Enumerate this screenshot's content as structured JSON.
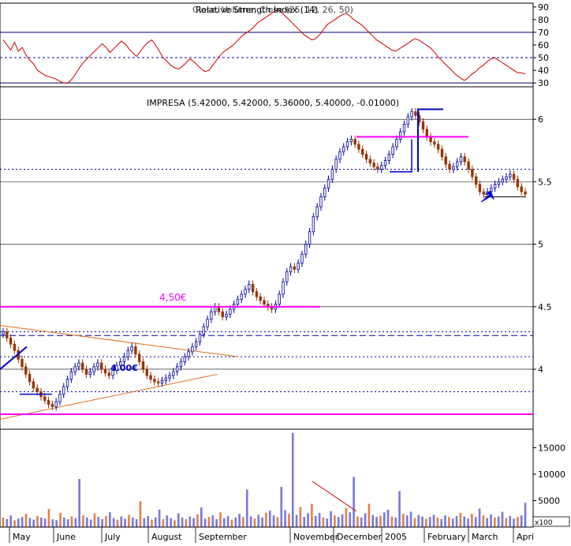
{
  "chart_data": [
    {
      "panel": "rsi",
      "type": "line",
      "title": "Relative Strength Index (14)",
      "overlay_text": "Close, Volume, Close (25, 12, 26, 50)",
      "y_ticks": [
        90,
        80,
        70,
        60,
        50,
        40,
        30
      ],
      "ylim": [
        27,
        93
      ],
      "reference_lines": [
        70,
        50,
        30
      ],
      "series": [
        {
          "color": "#cc0000",
          "values": [
            64,
            60,
            56,
            62,
            55,
            58,
            52,
            48,
            45,
            40,
            38,
            36,
            35,
            34,
            33,
            31,
            30,
            30,
            33,
            37,
            42,
            46,
            49,
            52,
            55,
            58,
            61,
            58,
            54,
            57,
            60,
            63,
            61,
            57,
            54,
            51,
            55,
            59,
            62,
            64,
            60,
            55,
            50,
            47,
            44,
            42,
            41,
            43,
            46,
            49,
            47,
            44,
            41,
            39,
            40,
            44,
            48,
            52,
            55,
            57,
            59,
            62,
            65,
            68,
            70,
            72,
            75,
            78,
            80,
            82,
            84,
            86,
            88,
            86,
            83,
            80,
            77,
            74,
            71,
            68,
            66,
            64,
            65,
            68,
            72,
            76,
            78,
            80,
            82,
            84,
            85,
            83,
            80,
            78,
            76,
            73,
            70,
            67,
            64,
            62,
            60,
            58,
            56,
            55,
            57,
            59,
            61,
            63,
            65,
            64,
            62,
            60,
            58,
            55,
            51,
            48,
            45,
            42,
            39,
            36,
            34,
            32,
            34,
            37,
            39,
            42,
            44,
            47,
            49,
            50,
            48,
            46,
            44,
            42,
            40,
            38,
            38,
            37
          ]
        }
      ]
    },
    {
      "panel": "price",
      "type": "candlestick",
      "title": "IMPRESA (5.42000, 5.42000, 5.36000, 5.40000, -0.01000)",
      "y_ticks": [
        6.0,
        5.5,
        5.0,
        4.5,
        4.0
      ],
      "ylim": [
        3.52,
        6.26
      ],
      "x_labels": [
        "May",
        "June",
        "July",
        "August",
        "September",
        "November",
        "December",
        "2005",
        "February",
        "March",
        "Apri"
      ],
      "close": [
        4.3,
        4.25,
        4.2,
        4.15,
        4.08,
        4.02,
        3.96,
        3.9,
        3.85,
        3.82,
        3.78,
        3.75,
        3.72,
        3.7,
        3.74,
        3.8,
        3.86,
        3.92,
        3.98,
        4.02,
        4.05,
        4.0,
        3.96,
        3.98,
        4.02,
        4.05,
        4.0,
        3.97,
        3.95,
        3.99,
        4.03,
        4.06,
        4.1,
        4.15,
        4.18,
        4.12,
        4.06,
        4.0,
        3.95,
        3.92,
        3.9,
        3.89,
        3.91,
        3.93,
        3.95,
        3.98,
        4.02,
        4.06,
        4.1,
        4.14,
        4.18,
        4.22,
        4.28,
        4.34,
        4.4,
        4.46,
        4.5,
        4.46,
        4.42,
        4.44,
        4.48,
        4.52,
        4.56,
        4.6,
        4.64,
        4.68,
        4.62,
        4.58,
        4.55,
        4.52,
        4.5,
        4.48,
        4.52,
        4.6,
        4.7,
        4.78,
        4.82,
        4.8,
        4.85,
        4.92,
        5.0,
        5.1,
        5.22,
        5.3,
        5.38,
        5.45,
        5.52,
        5.6,
        5.68,
        5.74,
        5.78,
        5.82,
        5.84,
        5.8,
        5.76,
        5.72,
        5.68,
        5.65,
        5.62,
        5.6,
        5.63,
        5.67,
        5.72,
        5.78,
        5.84,
        5.9,
        5.96,
        6.02,
        6.06,
        6.03,
        5.98,
        5.92,
        5.86,
        5.82,
        5.8,
        5.76,
        5.7,
        5.64,
        5.6,
        5.62,
        5.66,
        5.7,
        5.66,
        5.6,
        5.54,
        5.48,
        5.42,
        5.4,
        5.42,
        5.45,
        5.48,
        5.5,
        5.52,
        5.54,
        5.56,
        5.52,
        5.46,
        5.42,
        5.4
      ],
      "reference_lines": [
        {
          "value": 5.86,
          "color": "#ff00ff",
          "label": ""
        },
        {
          "value": 4.5,
          "color": "#ff00ff",
          "label": "4,50€"
        },
        {
          "value": 3.64,
          "color": "#ff00ff",
          "label": ""
        },
        {
          "value": 4.0,
          "color": "#0000cc",
          "label": "4.00€"
        }
      ],
      "annotations": [
        "4,50€",
        "4.00€"
      ]
    },
    {
      "panel": "volume",
      "type": "bar",
      "title": "",
      "y_ticks": [
        15000,
        10000,
        5000
      ],
      "ylim": [
        0,
        18500
      ],
      "unit_label": "x100",
      "series": [
        {
          "name": "",
          "values": [
            1800,
            1500,
            2200,
            1300,
            1600,
            1900,
            2500,
            1700,
            1400,
            2100,
            1800,
            1600,
            3400,
            1500,
            1300,
            2700,
            1800,
            1500,
            2000,
            1700,
            9100,
            2200,
            1800,
            1400,
            2600,
            1900,
            1500,
            2100,
            2800,
            1700,
            1400,
            2000,
            1600,
            2300,
            1800,
            1500,
            4900,
            1700,
            2100,
            1400,
            1800,
            3300,
            1500,
            2200,
            1700,
            1300,
            2600,
            1800,
            1500,
            2000,
            1700,
            2400,
            3700,
            1600,
            1900,
            2200,
            1500,
            2800,
            1700,
            2100,
            1400,
            1800,
            2500,
            1900,
            7100,
            2000,
            1600,
            2300,
            1800,
            2700,
            3100,
            2200,
            1900,
            7600,
            3200,
            2500,
            17800,
            2300,
            3800,
            1900,
            2600,
            4400,
            2100,
            2700,
            1800,
            1600,
            3000,
            2200,
            1900,
            2400,
            3600,
            2800,
            9500,
            2000,
            1800,
            2600,
            4400,
            2300,
            1900,
            2100,
            2800,
            3300,
            2000,
            1800,
            6800,
            2500,
            2200,
            2900,
            1700,
            2300,
            2000,
            1600,
            1900,
            2300,
            1800,
            1500,
            2200,
            1900,
            1600,
            2100,
            2700,
            2000,
            1600,
            2500,
            1900,
            3500,
            2200,
            1700,
            2400,
            1800,
            2000,
            2900,
            1700,
            2100,
            1600,
            1900,
            2200,
            4600
          ]
        }
      ]
    }
  ]
}
